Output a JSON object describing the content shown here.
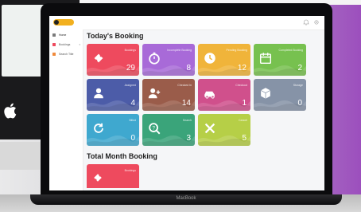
{
  "background": {
    "apple_icon": "apple-logo-icon"
  },
  "laptop": {
    "brand_label": "MacBook"
  },
  "app": {
    "logo_text": "",
    "sidebar": {
      "items": [
        {
          "label": "Home",
          "icon": "home-icon",
          "active": true
        },
        {
          "label": "Bookings",
          "icon": "bookings-icon",
          "active": false,
          "has_caret": true
        },
        {
          "label": "Search Title",
          "icon": "search-title-icon",
          "active": false
        }
      ]
    },
    "topbar_icons": [
      "notification-icon",
      "settings-icon"
    ]
  },
  "todays_booking": {
    "title": "Today's Booking",
    "cards": [
      {
        "label": "Bookings",
        "value": "29",
        "color": "#ee4a5e",
        "icon": "ticket-icon"
      },
      {
        "label": "Incomplete Booking",
        "value": "8",
        "color": "#a86ad8",
        "icon": "timer-icon"
      },
      {
        "label": "Pending Booking",
        "value": "12",
        "color": "#f0b43a",
        "icon": "clock-icon"
      },
      {
        "label": "Completed Booking",
        "value": "2",
        "color": "#77c14f",
        "icon": "calendar-icon"
      },
      {
        "label": "Assigned",
        "value": "4",
        "color": "#4c5ca8",
        "icon": "user-icon"
      },
      {
        "label": "Checked In",
        "value": "14",
        "color": "#9a5c4a",
        "icon": "user-add-icon"
      },
      {
        "label": "Checkout",
        "value": "1",
        "color": "#d0508c",
        "icon": "car-icon"
      },
      {
        "label": "Storage",
        "value": "0",
        "color": "#8693a7",
        "icon": "box-icon"
      },
      {
        "label": "Billed",
        "value": "0",
        "color": "#3fa8cf",
        "icon": "refresh-icon"
      },
      {
        "label": "Search",
        "value": "3",
        "color": "#3aa47a",
        "icon": "search-icon"
      },
      {
        "label": "Cancel",
        "value": "5",
        "color": "#b6cf47",
        "icon": "close-icon"
      }
    ]
  },
  "total_month_booking": {
    "title": "Total Month Booking",
    "cards": [
      {
        "label": "Bookings",
        "color": "#ee4a5e",
        "icon": "ticket-icon"
      }
    ]
  }
}
